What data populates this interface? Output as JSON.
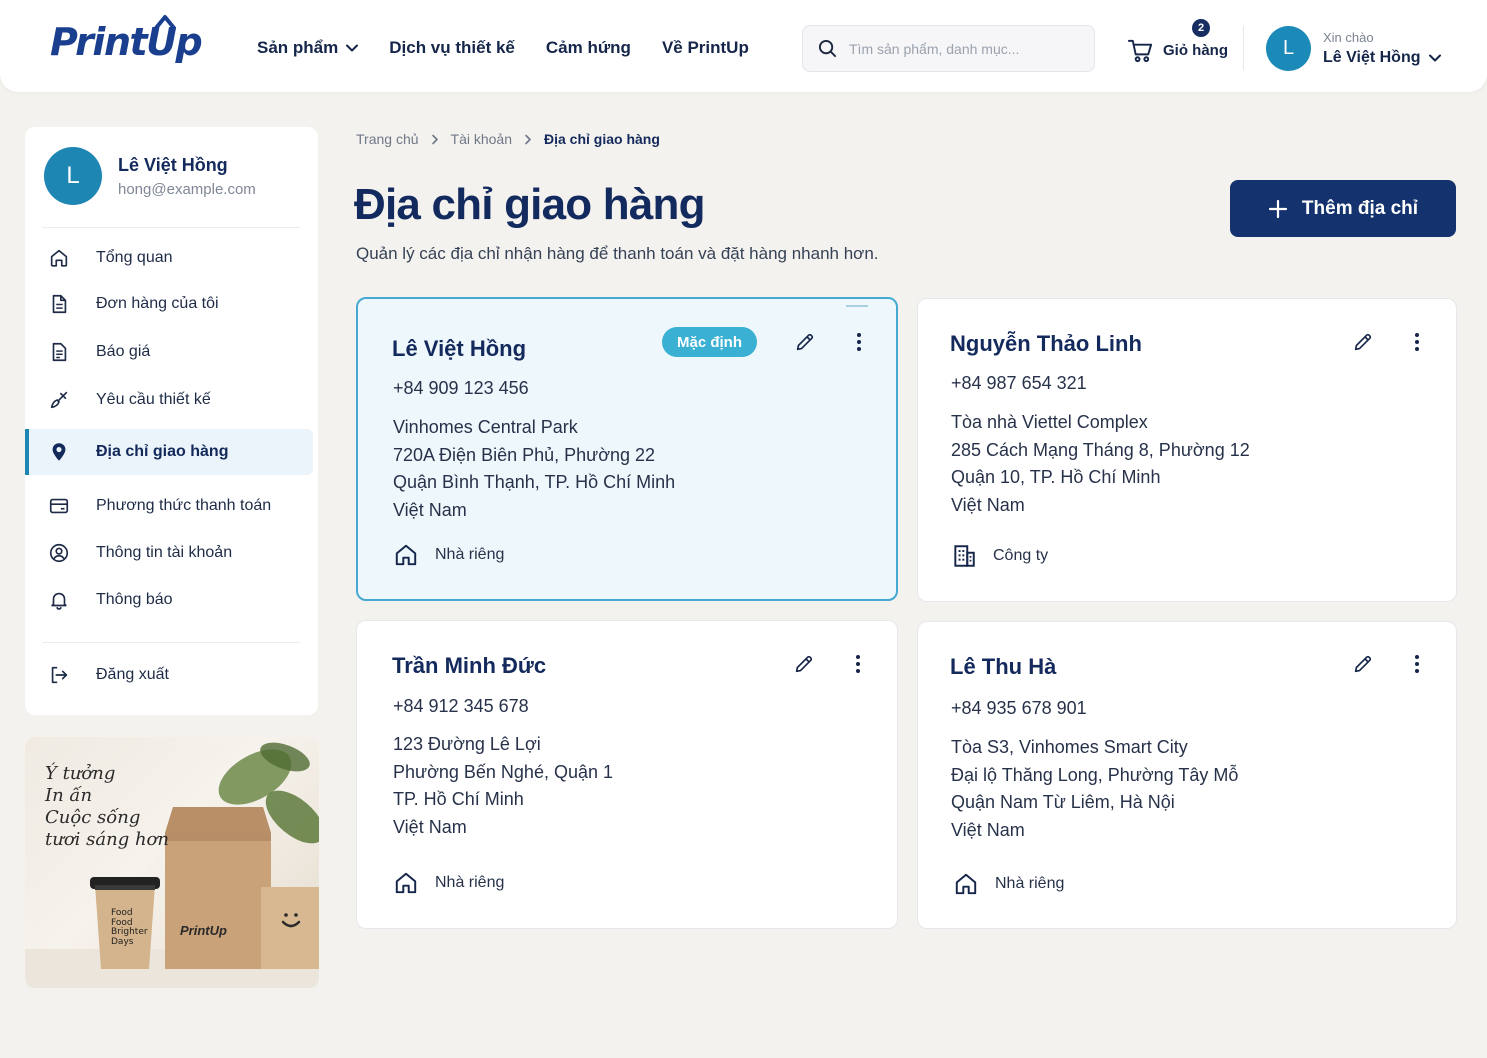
{
  "header": {
    "logo": "PrintUp",
    "nav": [
      {
        "label": "Sản phẩm",
        "has_dropdown": true
      },
      {
        "label": "Dịch vụ thiết kế",
        "has_dropdown": false
      },
      {
        "label": "Cảm hứng",
        "has_dropdown": false
      },
      {
        "label": "Về PrintUp",
        "has_dropdown": false
      }
    ],
    "search_placeholder": "Tìm sản phẩm, danh mục...",
    "cart_label": "Giỏ hàng",
    "cart_count": "2",
    "greeting": "Xin chào",
    "user_name": "Lê Việt Hồng",
    "avatar_initial": "L"
  },
  "sidebar": {
    "profile": {
      "initial": "L",
      "name": "Lê Việt Hồng",
      "email": "hong@example.com"
    },
    "items": [
      {
        "label": "Tổng quan",
        "icon": "home-icon"
      },
      {
        "label": "Đơn hàng của tôi",
        "icon": "document-icon"
      },
      {
        "label": "Báo giá",
        "icon": "quote-icon"
      },
      {
        "label": "Yêu cầu thiết kế",
        "icon": "brush-icon"
      },
      {
        "label": "Địa chỉ giao hàng",
        "icon": "location-pin-icon",
        "active": true
      },
      {
        "label": "Phương thức thanh toán",
        "icon": "credit-card-icon"
      },
      {
        "label": "Thông tin tài khoản",
        "icon": "user-circle-icon"
      },
      {
        "label": "Thông báo",
        "icon": "bell-icon"
      }
    ],
    "logout": {
      "label": "Đăng xuất",
      "icon": "logout-icon"
    }
  },
  "promo": {
    "tagline": [
      "Ý tưởng",
      "In ấn",
      "Cuộc sống",
      "tươi sáng hơn"
    ],
    "bag_brand": "PrintUp",
    "cup_text": [
      "Food",
      "Food",
      "Brighter",
      "Days"
    ]
  },
  "breadcrumb": {
    "items": [
      "Trang chủ",
      "Tài khoản"
    ],
    "current": "Địa chỉ giao hàng"
  },
  "page": {
    "title": "Địa chỉ giao hàng",
    "subtitle": "Quản lý các địa chỉ nhận hàng để thanh toán và đặt hàng nhanh hơn.",
    "add_button": "Thêm địa chỉ"
  },
  "addresses": [
    {
      "name": "Lê Việt Hồng",
      "phone": "+84 909 123 456",
      "lines": [
        "Vinhomes Central Park",
        "720A Điện Biên Phủ, Phường 22",
        "Quận Bình Thạnh, TP. Hồ Chí Minh",
        "Việt Nam"
      ],
      "type": "Nhà riêng",
      "type_icon": "home-icon",
      "default": true,
      "default_label": "Mặc định"
    },
    {
      "name": "Nguyễn Thảo Linh",
      "phone": "+84 987 654 321",
      "lines": [
        "Tòa nhà Viettel Complex",
        "285 Cách Mạng Tháng 8, Phường 12",
        "Quận 10, TP. Hồ Chí Minh",
        "Việt Nam"
      ],
      "type": "Công ty",
      "type_icon": "building-icon",
      "default": false
    },
    {
      "name": "Trần Minh Đức",
      "phone": "+84 912 345 678",
      "lines": [
        "123 Đường Lê Lợi",
        "Phường Bến Nghé, Quận 1",
        "TP. Hồ Chí Minh",
        "Việt Nam"
      ],
      "type": "Nhà riêng",
      "type_icon": "home-icon",
      "default": false
    },
    {
      "name": "Lê Thu Hà",
      "phone": "+84 935 678 901",
      "lines": [
        "Tòa S3, Vinhomes Smart City",
        "Đại lộ Thăng Long, Phường Tây Mỗ",
        "Quận Nam Từ Liêm, Hà Nội",
        "Việt Nam"
      ],
      "type": "Nhà riêng",
      "type_icon": "home-icon",
      "default": false
    }
  ],
  "colors": {
    "primary": "#14326e",
    "accent": "#1d86b3",
    "badge": "#3ab0d2",
    "default_card_bg": "#eef7fc",
    "page_bg": "#f4f2ee"
  }
}
